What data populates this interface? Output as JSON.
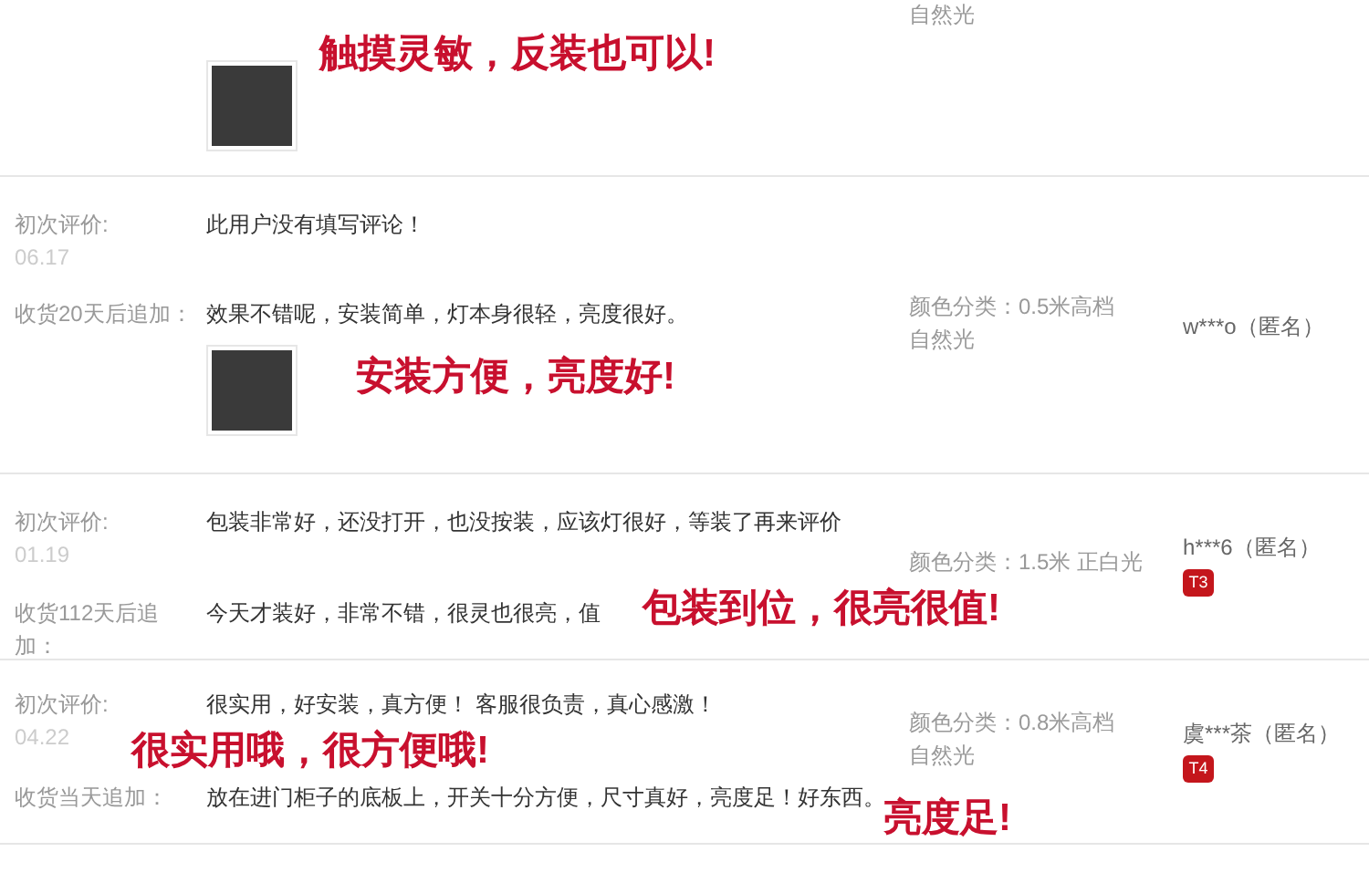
{
  "reviews": [
    {
      "sku": "自然光",
      "append": {
        "has_image": true
      },
      "annotations": [
        "触摸灵敏，反装也可以!"
      ]
    },
    {
      "initial": {
        "label": "初次评价:",
        "date": "06.17",
        "text": "此用户没有填写评论！"
      },
      "append": {
        "label": "收货20天后追加：",
        "text": "效果不错呢，安装简单，灯本身很轻，亮度很好。",
        "has_image": true
      },
      "sku": "颜色分类：0.5米高档自然光",
      "user": "w***o（匿名）",
      "annotations": [
        "安装方便，亮度好!"
      ]
    },
    {
      "initial": {
        "label": "初次评价:",
        "date": "01.19",
        "text": "包装非常好，还没打开，也没按装，应该灯很好，等装了再来评价"
      },
      "append": {
        "label": "收货112天后追加：",
        "text": "今天才装好，非常不错，很灵也很亮，值",
        "has_image": false
      },
      "sku": "颜色分类：1.5米 正白光",
      "user": "h***6（匿名）",
      "badge": "T3",
      "annotations": [
        "包装到位，很亮很值!"
      ]
    },
    {
      "initial": {
        "label": "初次评价:",
        "date": "04.22",
        "text": "很实用，好安装，真方便！ 客服很负责，真心感激！"
      },
      "append": {
        "label": "收货当天追加：",
        "text": "放在进门柜子的底板上，开关十分方便，尺寸真好，亮度足！好东西。",
        "has_image": false
      },
      "sku": "颜色分类：0.8米高档自然光",
      "user": "虞***茶（匿名）",
      "badge": "T4",
      "annotations": [
        "很实用哦，很方便哦!",
        "亮度足!"
      ]
    }
  ]
}
